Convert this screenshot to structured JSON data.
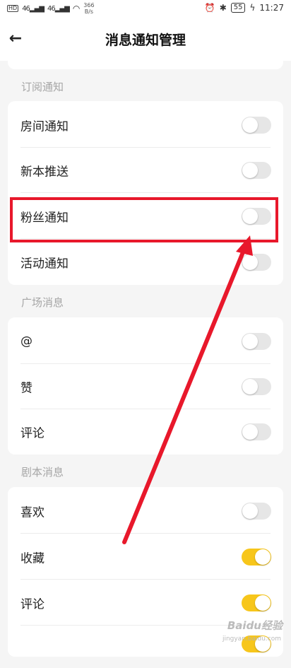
{
  "status_bar": {
    "signal_left": "46",
    "signal_right": "46",
    "net_speed": "366",
    "net_unit": "B/s",
    "battery": "55",
    "time": "11:27"
  },
  "navbar": {
    "title": "消息通知管理"
  },
  "sections": [
    {
      "header": "订阅通知",
      "items": [
        {
          "label": "房间通知",
          "enabled": false
        },
        {
          "label": "新本推送",
          "enabled": false
        },
        {
          "label": "粉丝通知",
          "enabled": false
        },
        {
          "label": "活动通知",
          "enabled": false
        }
      ]
    },
    {
      "header": "广场消息",
      "items": [
        {
          "label": "@",
          "enabled": false
        },
        {
          "label": "赞",
          "enabled": false
        },
        {
          "label": "评论",
          "enabled": false
        }
      ]
    },
    {
      "header": "剧本消息",
      "items": [
        {
          "label": "喜欢",
          "enabled": false
        },
        {
          "label": "收藏",
          "enabled": true
        },
        {
          "label": "评论",
          "enabled": true
        },
        {
          "label": "",
          "enabled": true
        }
      ]
    }
  ],
  "colors": {
    "toggle_on": "#f7c61b",
    "toggle_off": "#e6e6e6",
    "annotation": "#e8182b"
  },
  "watermark": {
    "brand": "Baidu经验",
    "url": "jingyan.baidu.com"
  }
}
